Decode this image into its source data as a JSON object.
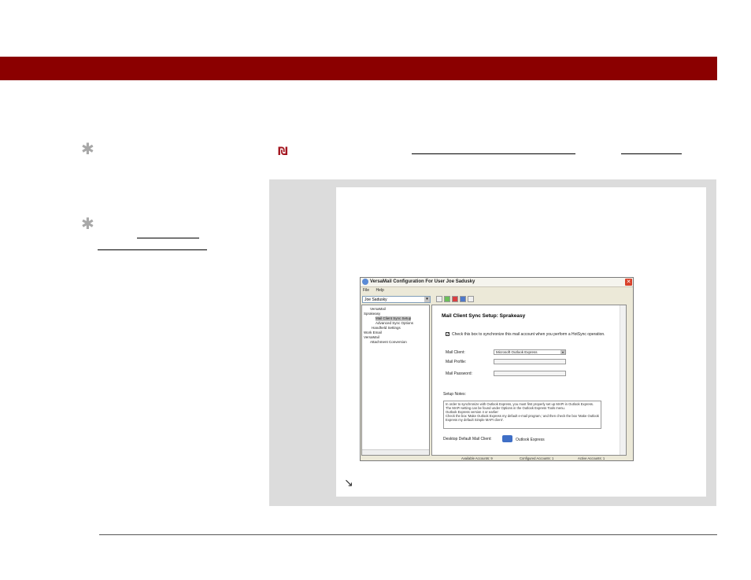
{
  "colors": {
    "banner": "#8b0000",
    "note_icon": "#a3141e",
    "panel_bg": "#dcdcdc"
  },
  "icons": {
    "sidebar_bullet_1": "asterisk-icon",
    "sidebar_bullet_2": "asterisk-icon",
    "note": "note-icon",
    "continue": "arrow-down-right-icon"
  },
  "glyphs": {
    "asterisk": "✱",
    "note": "₪",
    "arrow": "↘",
    "close": "✕",
    "checkmark": "✓",
    "dropdown": "▾"
  },
  "screenshot": {
    "window_title": "VersaMail Configuration For User Joe Sadusky",
    "menu": [
      "File",
      "Help"
    ],
    "user_select": "Joe Sadusky",
    "tree": [
      "VersaMail",
      "Sprakeasy",
      "Mail Client Sync Setup",
      "Advanced Sync Options",
      "Handheld Settings",
      "Work Email",
      "VersaMail",
      "Attachment Conversion"
    ],
    "heading": "Mail Client Sync Setup: Sprakeasy",
    "checkbox_label": "Check this box to synchronize this mail account when you perform a HotSync operation.",
    "mail_client_label": "Mail Client:",
    "mail_client_value": "Microsoft Outlook Express",
    "mail_profile_label": "Mail Profile:",
    "mail_password_label": "Mail Password:",
    "setup_notes_label": "Setup Notes:",
    "setup_notes_line1": "In order to synchronize with Outlook Express, you must first properly set up MAPI in Outlook Express. The MAPI setting can be found under Options in the Outlook Express Tools menu.",
    "setup_notes_line2": "Outlook Express version 4 or earlier:",
    "setup_notes_line3": "Check the box 'Make Outlook Express my default e-mail program,' and then check the box 'Make Outlook Express my default Simple MAPI client'.",
    "default_client_label": "Desktop Default Mail Client:",
    "default_client_value": "Outlook Express",
    "status_available": "Available Accounts: 9",
    "status_configured": "Configured Accounts: 1",
    "status_active": "Active Accounts: 1"
  }
}
